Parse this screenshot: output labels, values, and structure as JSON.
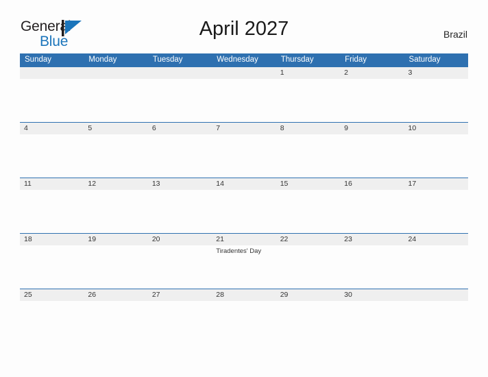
{
  "brand": {
    "line1": "General",
    "line2": "Blue",
    "mark_icon": "blue-triangle-logo-icon",
    "accent_color": "#1b75bb"
  },
  "header": {
    "title": "April 2027",
    "country": "Brazil"
  },
  "theme": {
    "header_blue": "#2e70b0",
    "band_gray": "#efefef",
    "page_background": "#fdfdfd",
    "text_color": "#333333"
  },
  "calendar": {
    "weekdays": [
      "Sunday",
      "Monday",
      "Tuesday",
      "Wednesday",
      "Thursday",
      "Friday",
      "Saturday"
    ],
    "weeks": [
      [
        {
          "day": ""
        },
        {
          "day": ""
        },
        {
          "day": ""
        },
        {
          "day": ""
        },
        {
          "day": "1"
        },
        {
          "day": "2"
        },
        {
          "day": "3"
        }
      ],
      [
        {
          "day": "4"
        },
        {
          "day": "5"
        },
        {
          "day": "6"
        },
        {
          "day": "7"
        },
        {
          "day": "8"
        },
        {
          "day": "9"
        },
        {
          "day": "10"
        }
      ],
      [
        {
          "day": "11"
        },
        {
          "day": "12"
        },
        {
          "day": "13"
        },
        {
          "day": "14"
        },
        {
          "day": "15"
        },
        {
          "day": "16"
        },
        {
          "day": "17"
        }
      ],
      [
        {
          "day": "18"
        },
        {
          "day": "19"
        },
        {
          "day": "20"
        },
        {
          "day": "21",
          "event": "Tiradentes' Day"
        },
        {
          "day": "22"
        },
        {
          "day": "23"
        },
        {
          "day": "24"
        }
      ],
      [
        {
          "day": "25"
        },
        {
          "day": "26"
        },
        {
          "day": "27"
        },
        {
          "day": "28"
        },
        {
          "day": "29"
        },
        {
          "day": "30"
        },
        {
          "day": ""
        }
      ]
    ]
  }
}
